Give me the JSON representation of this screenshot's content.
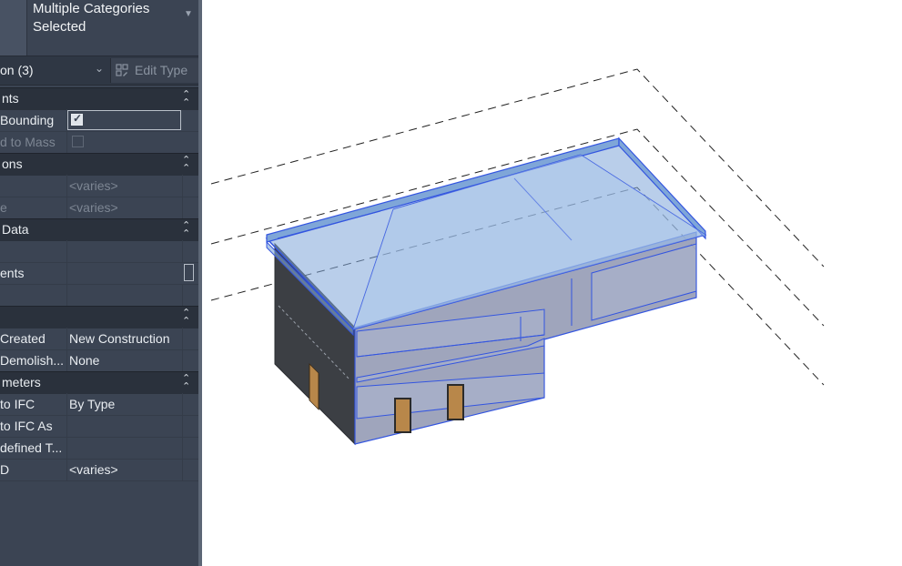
{
  "properties": {
    "header": {
      "title": "Multiple Categories Selected",
      "title_line1": "Multiple Categories",
      "title_line2": "Selected"
    },
    "filter": {
      "label": "on (3)",
      "edit_type_label": "Edit Type"
    },
    "sections": [
      {
        "label": "nts"
      },
      {
        "label": "ons"
      },
      {
        "label": "Data"
      },
      {
        "label": ""
      },
      {
        "label": "meters"
      }
    ],
    "rows": [
      {
        "label": "Bounding",
        "value": "",
        "checkbox": true,
        "checked": true
      },
      {
        "label": "d to Mass",
        "value": "",
        "checkbox": true,
        "checked": false,
        "dim": true
      },
      {
        "label": "",
        "value": "<varies>",
        "dim": true
      },
      {
        "label": "e",
        "value": "<varies>",
        "dim": true
      },
      {
        "label": "",
        "value": ""
      },
      {
        "label": "ents",
        "value": ""
      },
      {
        "label": "",
        "value": ""
      },
      {
        "label": "Created",
        "value": "New Construction"
      },
      {
        "label": "Demolish...",
        "value": "None"
      },
      {
        "label": "to IFC",
        "value": "By Type"
      },
      {
        "label": "to IFC As",
        "value": ""
      },
      {
        "label": "defined T...",
        "value": ""
      },
      {
        "label": "D",
        "value": "<varies>"
      }
    ]
  },
  "colors": {
    "panel_bg": "#3b4453",
    "section_bg": "#2a313c",
    "selection_blue": "#3355e0",
    "roof_fill": "#7fa6d8",
    "wall_dark": "#3c3f44",
    "door": "#b8874a"
  },
  "icons": [
    "edit-type-icon",
    "chevron-down-icon",
    "collapse-icon",
    "checkmark-icon"
  ]
}
